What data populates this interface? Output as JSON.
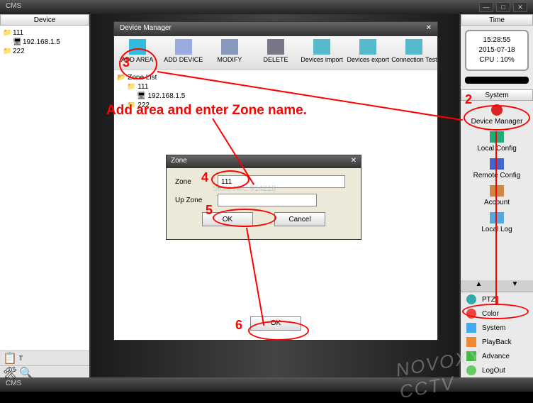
{
  "app_title": "CMS",
  "window_buttons": {
    "min": "—",
    "max": "□",
    "close": "✕"
  },
  "left": {
    "header": "Device",
    "tree": [
      {
        "icon": "zone",
        "label": "111"
      },
      {
        "icon": "dvr",
        "label": "192.168.1.5",
        "indent": true
      },
      {
        "icon": "zone",
        "label": "222"
      }
    ]
  },
  "right": {
    "header_time": "Time",
    "time_box": {
      "clock": "15:28:55",
      "date": "2015-07-18",
      "cpu": "CPU : 10%"
    },
    "header_system": "System",
    "sys_items": [
      {
        "icon": "#d22",
        "label": "Device Manager"
      },
      {
        "icon": "#2a7",
        "label": "Local Config"
      },
      {
        "icon": "#46c",
        "label": "Remote Config"
      },
      {
        "icon": "#c84",
        "label": "Account"
      },
      {
        "icon": "#5ad",
        "label": "Local Log"
      }
    ],
    "nav_items": [
      {
        "icon": "#3aa",
        "label": "PTZ"
      },
      {
        "icon": "#e44",
        "label": "Color"
      },
      {
        "icon": "#4ae",
        "label": "System"
      },
      {
        "icon": "#e83",
        "label": "PlayBack"
      },
      {
        "icon": "#4b4",
        "label": "Advance"
      },
      {
        "icon": "#6c6",
        "label": "LogOut"
      }
    ]
  },
  "dm": {
    "title": "Device Manager",
    "toolbar": [
      {
        "icon": "#3bd",
        "label": "ADD AREA"
      },
      {
        "icon": "#9ad",
        "label": "ADD DEVICE"
      },
      {
        "icon": "#89b",
        "label": "MODIFY"
      },
      {
        "icon": "#778",
        "label": "DELETE"
      },
      {
        "icon": "#5bc",
        "label": "Devices import"
      },
      {
        "icon": "#5bc",
        "label": "Devices export"
      },
      {
        "icon": "#5bc",
        "label": "Connection Test"
      }
    ],
    "tree_root": "Zone List",
    "tree": [
      {
        "icon": "zone",
        "label": "111"
      },
      {
        "icon": "dvr",
        "label": "192.168.1.5",
        "indent": true
      },
      {
        "icon": "zone",
        "label": "222"
      }
    ],
    "ok": "OK"
  },
  "zone": {
    "title": "Zone",
    "field1_label": "Zone",
    "field1_value": "111",
    "field2_label": "Up Zone",
    "ok": "OK",
    "cancel": "Cancel"
  },
  "annotations": {
    "main_text": "Add area and enter Zone name.",
    "nums": {
      "n1": "1",
      "n2": "2",
      "n3": "3",
      "n4": "4",
      "n5": "5",
      "n6": "6"
    }
  },
  "watermark_small": "Store No.: 914218",
  "watermark_big": "NOVOXY CCTV",
  "status": "CMS"
}
